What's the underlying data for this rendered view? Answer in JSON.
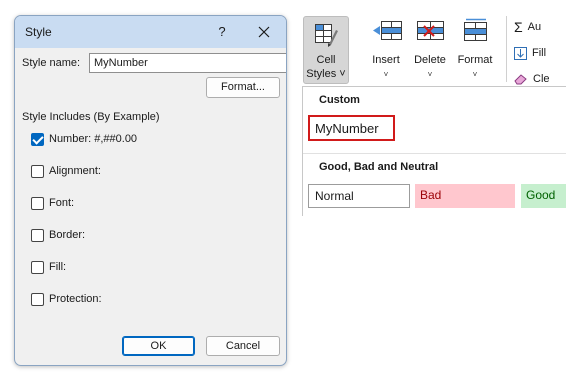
{
  "dialog": {
    "title": "Style",
    "help_label": "?",
    "style_name_label": "Style name:",
    "style_name_value": "MyNumber",
    "format_button": "Format...",
    "includes_title": "Style Includes (By Example)",
    "checkboxes": [
      {
        "label": "Number: #,##0.00",
        "checked": true
      },
      {
        "label": "Alignment:",
        "checked": false
      },
      {
        "label": "Font:",
        "checked": false
      },
      {
        "label": "Border:",
        "checked": false
      },
      {
        "label": "Fill:",
        "checked": false
      },
      {
        "label": "Protection:",
        "checked": false
      }
    ],
    "ok_button": "OK",
    "cancel_button": "Cancel"
  },
  "ribbon": {
    "cell_styles": {
      "line1": "Cell",
      "line2": "Styles ˅",
      "icon": "cell-styles-icon"
    },
    "insert": {
      "label": "Insert",
      "icon": "insert-cells-icon"
    },
    "delete": {
      "label": "Delete",
      "icon": "delete-cells-icon"
    },
    "format": {
      "label": "Format",
      "icon": "format-cells-icon"
    },
    "autosum": {
      "label": "Au",
      "icon": "sigma-icon"
    },
    "fill": {
      "label": "Fill",
      "icon": "fill-down-icon"
    },
    "clear": {
      "label": "Cle",
      "icon": "eraser-icon"
    }
  },
  "gallery": {
    "custom_header": "Custom",
    "custom_item": "MyNumber",
    "good_bad_header": "Good, Bad and Neutral",
    "styles": [
      {
        "label": "Normal"
      },
      {
        "label": "Bad"
      },
      {
        "label": "Good"
      }
    ]
  },
  "colors": {
    "highlight_border": "#d11a1a",
    "bad_fill": "#ffc7ce",
    "bad_text": "#9c0006",
    "good_fill": "#c6efce",
    "good_text": "#006100",
    "accent": "#0067c0"
  }
}
